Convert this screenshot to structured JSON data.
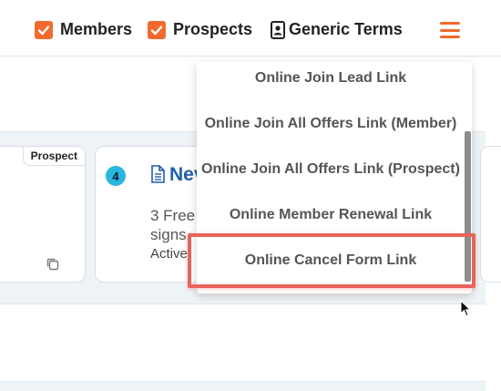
{
  "header": {
    "filters": [
      {
        "label": "Members",
        "checked": true
      },
      {
        "label": "Prospects",
        "checked": true
      }
    ],
    "generic_terms_label": "Generic Terms",
    "accent_color": "#f26a2e"
  },
  "cards": {
    "left": {
      "tag": "Prospect"
    },
    "main": {
      "badge": "4",
      "title": "Nev",
      "line1": "3 Free",
      "line2": "signs",
      "status": "Active"
    }
  },
  "dropdown": {
    "items": [
      {
        "label": "Online Join Lead Link"
      },
      {
        "label": "Online Join All Offers Link (Member)"
      },
      {
        "label": "Online Join All Offers Link (Prospect)"
      },
      {
        "label": "Online Member Renewal Link"
      },
      {
        "label": "Online Cancel Form Link",
        "highlighted": true
      }
    ]
  },
  "colors": {
    "highlight_border": "#e8645b",
    "badge": "#29b6e0",
    "title": "#1f5fa8"
  }
}
